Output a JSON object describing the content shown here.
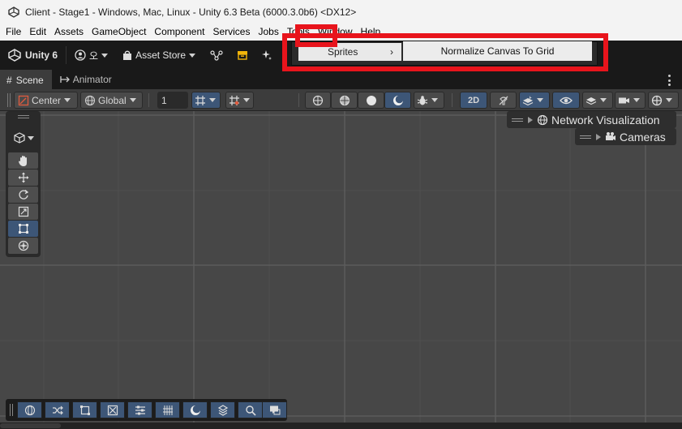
{
  "window": {
    "title": "Client - Stage1 - Windows, Mac, Linux - Unity 6.3 Beta (6000.3.0b6) <DX12>"
  },
  "menubar": {
    "items": [
      "File",
      "Edit",
      "Assets",
      "GameObject",
      "Component",
      "Services",
      "Jobs",
      "Tools",
      "Window",
      "Help"
    ]
  },
  "toolbar": {
    "unity_label": "Unity 6",
    "account_label": "오",
    "asset_store_label": "Asset Store"
  },
  "tabs": [
    {
      "label": "Scene",
      "active": true
    },
    {
      "label": "Animator",
      "active": false
    }
  ],
  "scene_toolbar": {
    "pivot_label": "Center",
    "space_label": "Global",
    "snap_value": "1",
    "mode_2d_label": "2D"
  },
  "overlays": {
    "network_label": "Network Visualization",
    "cameras_label": "Cameras"
  },
  "tools_menu": {
    "sprites_label": "Sprites",
    "submenu_item": "Normalize Canvas To Grid"
  },
  "colors": {
    "accent_selected": "#3d5677",
    "highlight_red": "#e8141c"
  }
}
